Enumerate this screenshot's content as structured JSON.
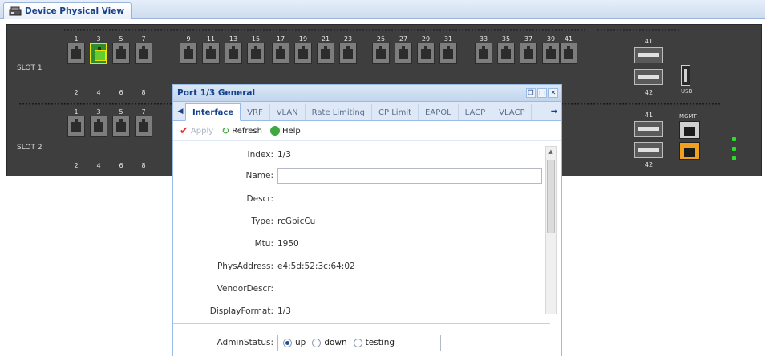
{
  "tab": {
    "title": "Device Physical View"
  },
  "chassis": {
    "slot1": {
      "label": "SLOT 1",
      "top_numbers": [
        "1",
        "3",
        "5",
        "7",
        "9",
        "11",
        "13",
        "15",
        "17",
        "19",
        "21",
        "23",
        "25",
        "27",
        "29",
        "31",
        "33",
        "35",
        "37",
        "39",
        "41"
      ],
      "bottom_numbers": [
        "2",
        "4",
        "6",
        "8",
        "42"
      ],
      "usb_label": "USB"
    },
    "slot2": {
      "label": "SLOT 2",
      "top_numbers": [
        "1",
        "3",
        "5",
        "7",
        "41"
      ],
      "bottom_numbers": [
        "2",
        "4",
        "6",
        "8",
        "42"
      ],
      "mgmt_label": "MGMT"
    },
    "selected_port": "1/3"
  },
  "dialog": {
    "title": "Port 1/3 General",
    "tabs": [
      "Interface",
      "VRF",
      "VLAN",
      "Rate Limiting",
      "CP Limit",
      "EAPOL",
      "LACP",
      "VLACP"
    ],
    "active_tab": "Interface",
    "toolbar": {
      "apply": "Apply",
      "refresh": "Refresh",
      "help": "Help"
    },
    "fields": {
      "index": {
        "label": "Index:",
        "value": "1/3"
      },
      "name": {
        "label": "Name:",
        "value": ""
      },
      "descr": {
        "label": "Descr:",
        "value": ""
      },
      "type": {
        "label": "Type:",
        "value": "rcGbicCu"
      },
      "mtu": {
        "label": "Mtu:",
        "value": "1950"
      },
      "phys_address": {
        "label": "PhysAddress:",
        "value": "e4:5d:52:3c:64:02"
      },
      "vendor_descr": {
        "label": "VendorDescr:",
        "value": ""
      },
      "display_format": {
        "label": "DisplayFormat:",
        "value": "1/3"
      },
      "admin_status": {
        "label": "AdminStatus:",
        "options": [
          "up",
          "down",
          "testing"
        ],
        "selected": "up"
      }
    }
  }
}
